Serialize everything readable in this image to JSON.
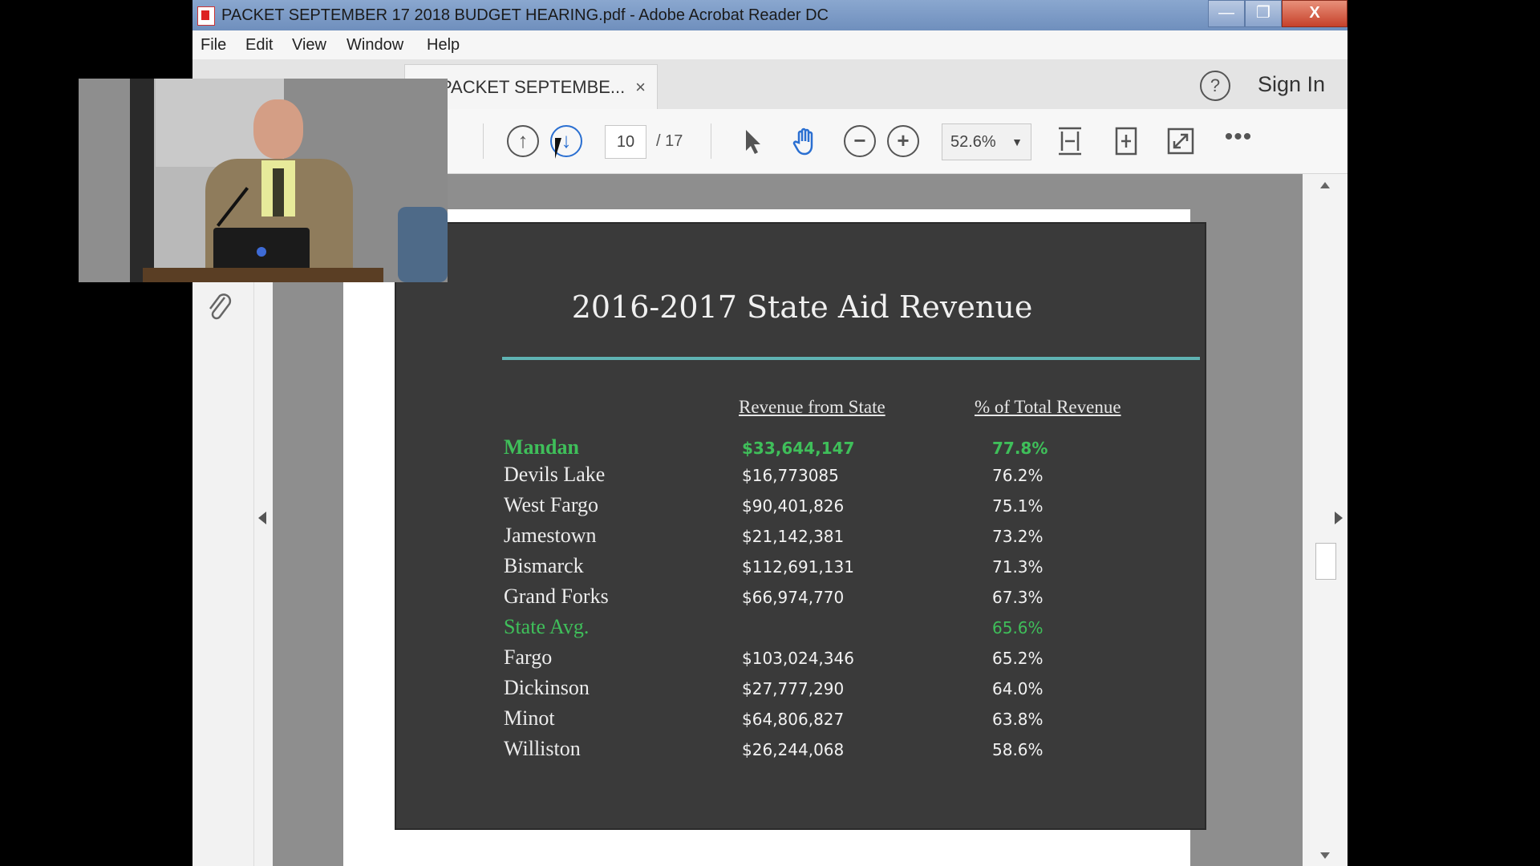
{
  "window": {
    "title": "PACKET SEPTEMBER 17 2018 BUDGET HEARING.pdf - Adobe Acrobat Reader DC",
    "minimize": "—",
    "maximize": "❐",
    "close": "X"
  },
  "menu": [
    "File",
    "Edit",
    "View",
    "Window",
    "Help"
  ],
  "tabs": {
    "doc_label": "PACKET SEPTEMBE...",
    "close": "×",
    "help_glyph": "?",
    "sign_in": "Sign In"
  },
  "toolbar": {
    "page_current": "10",
    "page_total": "/ 17",
    "zoom": "52.6%",
    "zoom_caret": "▼",
    "up_glyph": "↑",
    "down_glyph": "↓",
    "zoom_out_glyph": "−",
    "zoom_in_glyph": "+",
    "more_glyph": "•••"
  },
  "slide": {
    "title": "2016-2017 State Aid Revenue",
    "col_revenue": "Revenue from State",
    "col_percent": "% of Total Revenue",
    "rows": [
      {
        "name": "Mandan",
        "revenue": "$33,644,147",
        "percent": "77.8%"
      },
      {
        "name": "Devils Lake",
        "revenue": "$16,773085",
        "percent": "76.2%"
      },
      {
        "name": "West Fargo",
        "revenue": "$90,401,826",
        "percent": "75.1%"
      },
      {
        "name": "Jamestown",
        "revenue": "$21,142,381",
        "percent": "73.2%"
      },
      {
        "name": "Bismarck",
        "revenue": "$112,691,131",
        "percent": "71.3%"
      },
      {
        "name": "Grand Forks",
        "revenue": "$66,974,770",
        "percent": "67.3%"
      },
      {
        "name": "State Avg.",
        "revenue": "",
        "percent": "65.6%"
      },
      {
        "name": "Fargo",
        "revenue": "$103,024,346",
        "percent": "65.2%"
      },
      {
        "name": "Dickinson",
        "revenue": "$27,777,290",
        "percent": "64.0%"
      },
      {
        "name": "Minot",
        "revenue": "$64,806,827",
        "percent": "63.8%"
      },
      {
        "name": "Williston",
        "revenue": "$26,244,068",
        "percent": "58.6%"
      }
    ]
  },
  "colors": {
    "highlight": "#3fbf5a",
    "slide_bg": "#3a3a3a",
    "accent_blue": "#2a6fd1"
  }
}
